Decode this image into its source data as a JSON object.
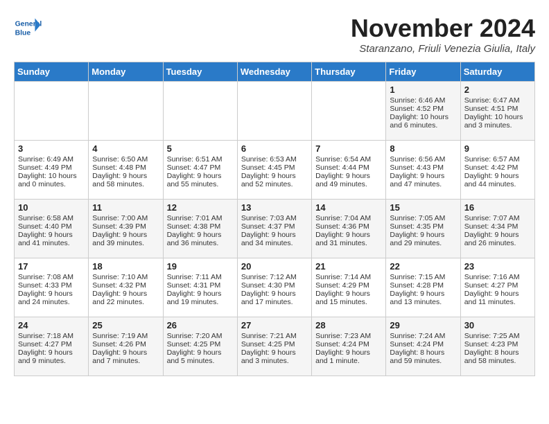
{
  "header": {
    "logo_text_general": "General",
    "logo_text_blue": "Blue",
    "month_title": "November 2024",
    "location": "Staranzano, Friuli Venezia Giulia, Italy"
  },
  "days_of_week": [
    "Sunday",
    "Monday",
    "Tuesday",
    "Wednesday",
    "Thursday",
    "Friday",
    "Saturday"
  ],
  "weeks": [
    [
      {
        "day": "",
        "content": ""
      },
      {
        "day": "",
        "content": ""
      },
      {
        "day": "",
        "content": ""
      },
      {
        "day": "",
        "content": ""
      },
      {
        "day": "",
        "content": ""
      },
      {
        "day": "1",
        "content": "Sunrise: 6:46 AM\nSunset: 4:52 PM\nDaylight: 10 hours and 6 minutes."
      },
      {
        "day": "2",
        "content": "Sunrise: 6:47 AM\nSunset: 4:51 PM\nDaylight: 10 hours and 3 minutes."
      }
    ],
    [
      {
        "day": "3",
        "content": "Sunrise: 6:49 AM\nSunset: 4:49 PM\nDaylight: 10 hours and 0 minutes."
      },
      {
        "day": "4",
        "content": "Sunrise: 6:50 AM\nSunset: 4:48 PM\nDaylight: 9 hours and 58 minutes."
      },
      {
        "day": "5",
        "content": "Sunrise: 6:51 AM\nSunset: 4:47 PM\nDaylight: 9 hours and 55 minutes."
      },
      {
        "day": "6",
        "content": "Sunrise: 6:53 AM\nSunset: 4:45 PM\nDaylight: 9 hours and 52 minutes."
      },
      {
        "day": "7",
        "content": "Sunrise: 6:54 AM\nSunset: 4:44 PM\nDaylight: 9 hours and 49 minutes."
      },
      {
        "day": "8",
        "content": "Sunrise: 6:56 AM\nSunset: 4:43 PM\nDaylight: 9 hours and 47 minutes."
      },
      {
        "day": "9",
        "content": "Sunrise: 6:57 AM\nSunset: 4:42 PM\nDaylight: 9 hours and 44 minutes."
      }
    ],
    [
      {
        "day": "10",
        "content": "Sunrise: 6:58 AM\nSunset: 4:40 PM\nDaylight: 9 hours and 41 minutes."
      },
      {
        "day": "11",
        "content": "Sunrise: 7:00 AM\nSunset: 4:39 PM\nDaylight: 9 hours and 39 minutes."
      },
      {
        "day": "12",
        "content": "Sunrise: 7:01 AM\nSunset: 4:38 PM\nDaylight: 9 hours and 36 minutes."
      },
      {
        "day": "13",
        "content": "Sunrise: 7:03 AM\nSunset: 4:37 PM\nDaylight: 9 hours and 34 minutes."
      },
      {
        "day": "14",
        "content": "Sunrise: 7:04 AM\nSunset: 4:36 PM\nDaylight: 9 hours and 31 minutes."
      },
      {
        "day": "15",
        "content": "Sunrise: 7:05 AM\nSunset: 4:35 PM\nDaylight: 9 hours and 29 minutes."
      },
      {
        "day": "16",
        "content": "Sunrise: 7:07 AM\nSunset: 4:34 PM\nDaylight: 9 hours and 26 minutes."
      }
    ],
    [
      {
        "day": "17",
        "content": "Sunrise: 7:08 AM\nSunset: 4:33 PM\nDaylight: 9 hours and 24 minutes."
      },
      {
        "day": "18",
        "content": "Sunrise: 7:10 AM\nSunset: 4:32 PM\nDaylight: 9 hours and 22 minutes."
      },
      {
        "day": "19",
        "content": "Sunrise: 7:11 AM\nSunset: 4:31 PM\nDaylight: 9 hours and 19 minutes."
      },
      {
        "day": "20",
        "content": "Sunrise: 7:12 AM\nSunset: 4:30 PM\nDaylight: 9 hours and 17 minutes."
      },
      {
        "day": "21",
        "content": "Sunrise: 7:14 AM\nSunset: 4:29 PM\nDaylight: 9 hours and 15 minutes."
      },
      {
        "day": "22",
        "content": "Sunrise: 7:15 AM\nSunset: 4:28 PM\nDaylight: 9 hours and 13 minutes."
      },
      {
        "day": "23",
        "content": "Sunrise: 7:16 AM\nSunset: 4:27 PM\nDaylight: 9 hours and 11 minutes."
      }
    ],
    [
      {
        "day": "24",
        "content": "Sunrise: 7:18 AM\nSunset: 4:27 PM\nDaylight: 9 hours and 9 minutes."
      },
      {
        "day": "25",
        "content": "Sunrise: 7:19 AM\nSunset: 4:26 PM\nDaylight: 9 hours and 7 minutes."
      },
      {
        "day": "26",
        "content": "Sunrise: 7:20 AM\nSunset: 4:25 PM\nDaylight: 9 hours and 5 minutes."
      },
      {
        "day": "27",
        "content": "Sunrise: 7:21 AM\nSunset: 4:25 PM\nDaylight: 9 hours and 3 minutes."
      },
      {
        "day": "28",
        "content": "Sunrise: 7:23 AM\nSunset: 4:24 PM\nDaylight: 9 hours and 1 minute."
      },
      {
        "day": "29",
        "content": "Sunrise: 7:24 AM\nSunset: 4:24 PM\nDaylight: 8 hours and 59 minutes."
      },
      {
        "day": "30",
        "content": "Sunrise: 7:25 AM\nSunset: 4:23 PM\nDaylight: 8 hours and 58 minutes."
      }
    ]
  ]
}
